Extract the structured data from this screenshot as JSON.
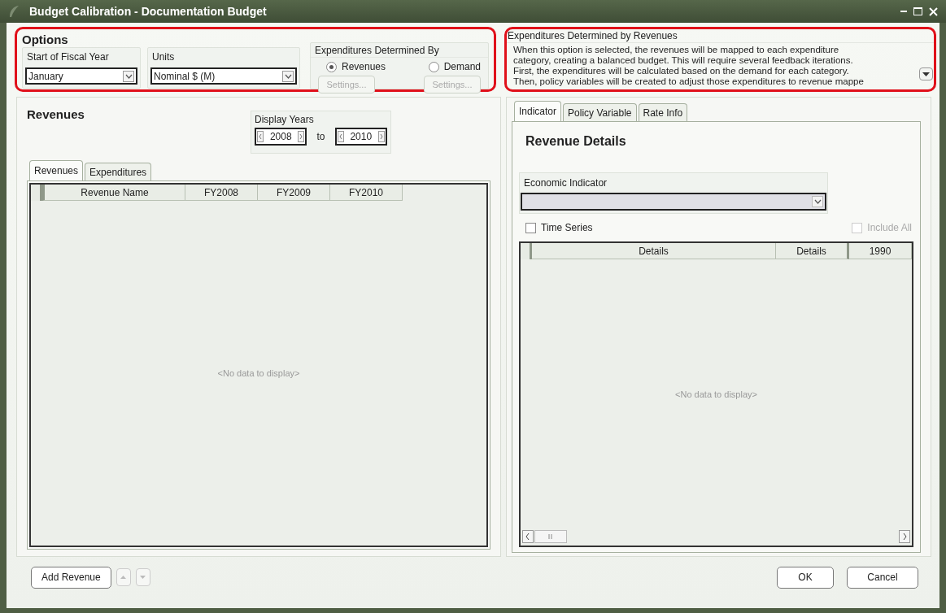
{
  "window": {
    "title": "Budget Calibration - Documentation Budget"
  },
  "options": {
    "title": "Options",
    "fiscal_year": {
      "label": "Start of Fiscal Year",
      "value": "January"
    },
    "units": {
      "label": "Units",
      "value": "Nominal $ (M)"
    },
    "expenditures_by": {
      "label": "Expenditures Determined By",
      "choices": [
        {
          "label": "Revenues",
          "selected": true,
          "button": {
            "label": "Settings...",
            "disabled": true
          }
        },
        {
          "label": "Demand",
          "selected": false,
          "button": {
            "label": "Settings...",
            "disabled": true
          }
        }
      ]
    }
  },
  "description": {
    "title": "Expenditures Determined by Revenues",
    "lines": [
      "When this option is selected, the revenues will be mapped to each expenditure",
      "category, creating a balanced budget. This will require several feedback iterations.",
      "First, the expenditures will be calculated based on the demand for each category.",
      "Then, policy variables will be created to adjust those expenditures to revenue mappe"
    ]
  },
  "revenues": {
    "title": "Revenues",
    "display_years": {
      "label": "Display Years",
      "from": "2008",
      "separator": "to",
      "to": "2010"
    },
    "tabs": [
      {
        "label": "Revenues",
        "selected": true
      },
      {
        "label": "Expenditures",
        "selected": false
      }
    ],
    "table": {
      "columns": [
        "Revenue Name",
        "FY2008",
        "FY2009",
        "FY2010"
      ],
      "empty_text": "<No data to display>"
    }
  },
  "details": {
    "tabs": [
      {
        "label": "Indicator",
        "selected": true
      },
      {
        "label": "Policy Variable",
        "selected": false
      },
      {
        "label": "Rate Info",
        "selected": false
      }
    ],
    "title": "Revenue Details",
    "indicator": {
      "label": "Economic Indicator"
    },
    "time_series": {
      "label": "Time Series",
      "checked": false,
      "disabled": false
    },
    "include_all": {
      "label": "Include All",
      "checked": false,
      "disabled": true
    },
    "table": {
      "columns": [
        "Details",
        "Details",
        "1990"
      ],
      "empty_text": "<No data to display>"
    }
  },
  "footer": {
    "add_button": "Add Revenue",
    "move_buttons": [
      {
        "kind": "up",
        "disabled": true
      },
      {
        "kind": "down",
        "disabled": true
      }
    ],
    "ok": "OK",
    "cancel": "Cancel"
  }
}
